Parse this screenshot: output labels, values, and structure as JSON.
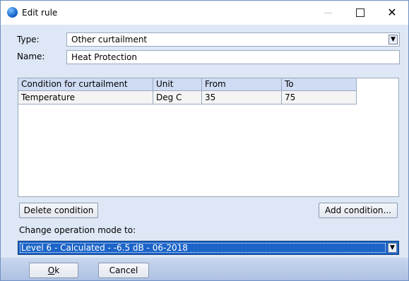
{
  "window": {
    "title": "Edit rule"
  },
  "type": {
    "label": "Type:",
    "value": "Other curtailment"
  },
  "name": {
    "label": "Name:",
    "value": "Heat Protection"
  },
  "table": {
    "columns": [
      "Condition for curtailment",
      "Unit",
      "From",
      "To"
    ],
    "rows": [
      [
        "Temperature",
        "Deg C",
        "35",
        "75"
      ]
    ]
  },
  "buttons": {
    "delete_condition": "Delete condition",
    "add_condition": "Add condition...",
    "ok_mnemonic": "O",
    "ok_rest": "k",
    "cancel": "Cancel"
  },
  "mode": {
    "label": "Change operation mode to:",
    "value": "Level 6 - Calculated - -6.5 dB - 06-2018"
  },
  "icons": {
    "app": "globe-icon",
    "dropdown": "chevron-down-icon",
    "close": "close-icon",
    "maximize": "maximize-icon",
    "minimize": "minimize-icon"
  },
  "colors": {
    "selection": "#1c64c8",
    "header": "#cfdcf3",
    "dialog_bg": "#dde7f5"
  }
}
